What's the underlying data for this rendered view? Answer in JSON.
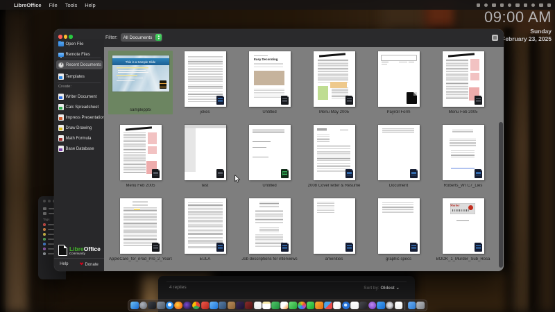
{
  "menubar": {
    "apple": "",
    "items": [
      "LibreOffice",
      "File",
      "Tools",
      "Help"
    ],
    "status_icons": [
      "grid-icon",
      "display-icon",
      "key-icon",
      "battery-icon",
      "wifi-icon",
      "search-icon",
      "control-center-icon",
      "siri-icon",
      "dot-icon",
      "clock-icon"
    ]
  },
  "clock": {
    "time": "09:00 AM",
    "day": "Sunday",
    "date": "February 23, 2025"
  },
  "window": {
    "filter_label": "Filter:",
    "filter_value": "All Documents",
    "sidebar": {
      "items": [
        {
          "id": "open-file",
          "label": "Open File",
          "icon": "folder",
          "selected": false
        },
        {
          "id": "remote-files",
          "label": "Remote Files",
          "icon": "screen",
          "selected": false
        },
        {
          "id": "recent-documents",
          "label": "Recent Documents",
          "icon": "clock",
          "selected": true
        },
        {
          "id": "templates",
          "label": "Templates",
          "icon": "doc:#2e86e0",
          "selected": false
        }
      ],
      "create_label": "Create:",
      "create_items": [
        {
          "id": "writer-document",
          "label": "Writer Document",
          "icon": "doc:#2e6ee0"
        },
        {
          "id": "calc-spreadsheet",
          "label": "Calc Spreadsheet",
          "icon": "doc:#2fae4f"
        },
        {
          "id": "impress-presentation",
          "label": "Impress Presentation",
          "icon": "doc:#d35b2a"
        },
        {
          "id": "draw-drawing",
          "label": "Draw Drawing",
          "icon": "doc:#d8b619"
        },
        {
          "id": "math-formula",
          "label": "Math Formula",
          "icon": "doc:#a02c2c"
        },
        {
          "id": "base-database",
          "label": "Base Database",
          "icon": "doc:#7b3fa8"
        }
      ],
      "logo": {
        "brand_green": "Libre",
        "brand_white": "Office",
        "community": "Community"
      },
      "help_label": "Help",
      "donate_label": "Donate"
    },
    "slide_title": "This is a Sample Slide",
    "documents": [
      {
        "name": "samplepptx",
        "kind": "slide",
        "badge": "impress",
        "selected": true
      },
      {
        "name": "jokes",
        "kind": "text",
        "badge": "blue"
      },
      {
        "name": "Untitled",
        "kind": "article",
        "badge": "black",
        "title_text": "Easy Decorating"
      },
      {
        "name": "Menu May 2005",
        "kind": "menu-green",
        "badge": "black"
      },
      {
        "name": "Payroll Form",
        "kind": "form",
        "badge": "bigblack"
      },
      {
        "name": "Menu Feb 2005",
        "kind": "menu-pink",
        "badge": "black"
      },
      {
        "name": "Menu Feb 2005",
        "kind": "menu-pink",
        "badge": "black"
      },
      {
        "name": "test",
        "kind": "test",
        "badge": "black"
      },
      {
        "name": "Untitled",
        "kind": "numbers",
        "badge": "green"
      },
      {
        "name": "2008 Cover letter & Resume",
        "kind": "letter",
        "badge": "blue"
      },
      {
        "name": "Document",
        "kind": "docmin",
        "badge": "blue"
      },
      {
        "name": "Roberts_WTC7_Lies",
        "kind": "mono",
        "badge": "blue"
      },
      {
        "name": "AppleCare_for_iPad_Pro_2_Years",
        "kind": "dense-h",
        "badge": "black"
      },
      {
        "name": "EULA",
        "kind": "dense",
        "badge": "blue"
      },
      {
        "name": "Job descriptions for interviews",
        "kind": "centered",
        "badge": "blue"
      },
      {
        "name": "amenities",
        "kind": "list",
        "badge": "blue"
      },
      {
        "name": "graphic specs",
        "kind": "para",
        "badge": "blue"
      },
      {
        "name": "BOOK_1_Murder_Sub_Rosa",
        "kind": "murder",
        "badge": "blue",
        "title_text": "Murder"
      }
    ]
  },
  "background_window": {
    "replies": "4 replies",
    "sort_label": "Sort by:",
    "sort_value": "Oldest",
    "sort_caret": "⌄"
  },
  "finder_panel": {
    "tags_label": "Tags",
    "tag_colors": [
      "#e0443e",
      "#e8883a",
      "#e5c93c",
      "#4fb356",
      "#3b82e0",
      "#9b59b6",
      "#9aa0a6"
    ]
  },
  "dock": {
    "icons": [
      {
        "name": "finder",
        "bg": "linear-gradient(135deg,#6fc3f7,#1667cf)",
        "shape": "sq"
      },
      {
        "name": "siri",
        "bg": "radial-gradient(circle at 35% 35%,#aeb3bd,#62666e)",
        "shape": "circ"
      },
      {
        "name": "launchpad",
        "bg": "linear-gradient(135deg,#3c4048,#16181c)",
        "shape": "sq"
      },
      {
        "name": "mission-control",
        "bg": "linear-gradient(135deg,#8c97a6,#4a5563)",
        "shape": "sq"
      },
      {
        "name": "safari",
        "bg": "radial-gradient(circle at 50% 40%,#f4f6f8 30%,#2f8de8 32%)",
        "shape": "circ"
      },
      {
        "name": "firefox",
        "bg": "radial-gradient(circle at 40% 40%,#ffd23e,#f26a1b 70%)",
        "shape": "circ"
      },
      {
        "name": "firefox-dark",
        "bg": "radial-gradient(circle at 40% 40%,#7a4bd1,#2a1a55 75%)",
        "shape": "circ"
      },
      {
        "name": "chrome",
        "bg": "conic-gradient(#ea4335 0 33%,#34a853 33% 66%,#fbbc05 66% 100%)",
        "shape": "circ"
      },
      {
        "name": "shield-app",
        "bg": "linear-gradient(135deg,#f05a4c,#b0241a)",
        "shape": "sq"
      },
      {
        "name": "mail",
        "bg": "linear-gradient(135deg,#6db9f9,#1a72d8)",
        "shape": "sq"
      },
      {
        "name": "flags-app",
        "bg": "linear-gradient(135deg,#5a80a8,#2c4a70)",
        "shape": "sq"
      },
      {
        "name": "files-folder",
        "bg": "linear-gradient(135deg,#b98e5c,#8a5f33)",
        "shape": "sq"
      },
      {
        "name": "after-effects",
        "bg": "linear-gradient(135deg,#3a2a55,#1a1030)",
        "shape": "sq"
      },
      {
        "name": "photo-app-red",
        "bg": "linear-gradient(135deg,#8a2c2c,#501212)",
        "shape": "sq"
      },
      {
        "name": "calendar",
        "bg": "linear-gradient(#f5f5f5 55%,#e8e8e8)",
        "shape": "sq"
      },
      {
        "name": "notes",
        "bg": "linear-gradient(#f7e9a8 25%,#ffffff 26%)",
        "shape": "sq"
      },
      {
        "name": "pages-puzzle",
        "bg": "linear-gradient(135deg,#52c56a,#1d8f3c)",
        "shape": "sq"
      },
      {
        "name": "grid-app",
        "bg": "linear-gradient(135deg,#ffffff 50%,#f08a2c)",
        "shape": "sq"
      },
      {
        "name": "messages",
        "bg": "linear-gradient(135deg,#6ee07a,#20a333)",
        "shape": "sq"
      },
      {
        "name": "photos",
        "bg": "conic-gradient(#f2b21d,#ea4a3c,#b14fc5,#3478f6,#30b0c7,#5bc236,#f2b21d)",
        "shape": "circ2"
      },
      {
        "name": "facetime",
        "bg": "linear-gradient(135deg,#5ce06a,#18a72c)",
        "shape": "sq"
      },
      {
        "name": "pencil-app",
        "bg": "linear-gradient(135deg,#f8b133,#e06a12)",
        "shape": "sq"
      },
      {
        "name": "parasol-app",
        "bg": "linear-gradient(135deg,#4aa3e8 50%,#e84a4a 50%)",
        "shape": "sq"
      },
      {
        "name": "news",
        "bg": "linear-gradient(135deg,#fafafa 60%,#e8e8e8)",
        "shape": "sq"
      },
      {
        "name": "maps-compass",
        "bg": "radial-gradient(circle at 45% 45%,#cfe8ff 25%,#2470d8 27%)",
        "shape": "circ"
      },
      {
        "name": "music",
        "bg": "linear-gradient(#ffffff,#f0f0f0)",
        "shape": "sq"
      },
      {
        "name": "binoculars-app",
        "bg": "linear-gradient(135deg,#4a4a50,#1f1f24)",
        "shape": "sq"
      },
      {
        "name": "podcasts",
        "bg": "radial-gradient(circle at 45% 40%,#c08cf0,#6a30c0)",
        "shape": "circ"
      },
      {
        "name": "app-store",
        "bg": "linear-gradient(135deg,#4aa8f5,#1468d0)",
        "shape": "sq"
      },
      {
        "name": "system-settings",
        "bg": "radial-gradient(circle at 50% 45%,#d8d8dc 30%,#8a8a90 70%)",
        "shape": "circ"
      },
      {
        "name": "textedit",
        "bg": "linear-gradient(#ffffff,#ececec)",
        "shape": "sq"
      }
    ],
    "tail": [
      {
        "name": "downloads-folder",
        "bg": "linear-gradient(135deg,#6aaef5,#2e7ad0)",
        "shape": "sq"
      },
      {
        "name": "trash",
        "bg": "linear-gradient(135deg,#b9bcc2,#7e8288)",
        "shape": "sq"
      }
    ]
  }
}
